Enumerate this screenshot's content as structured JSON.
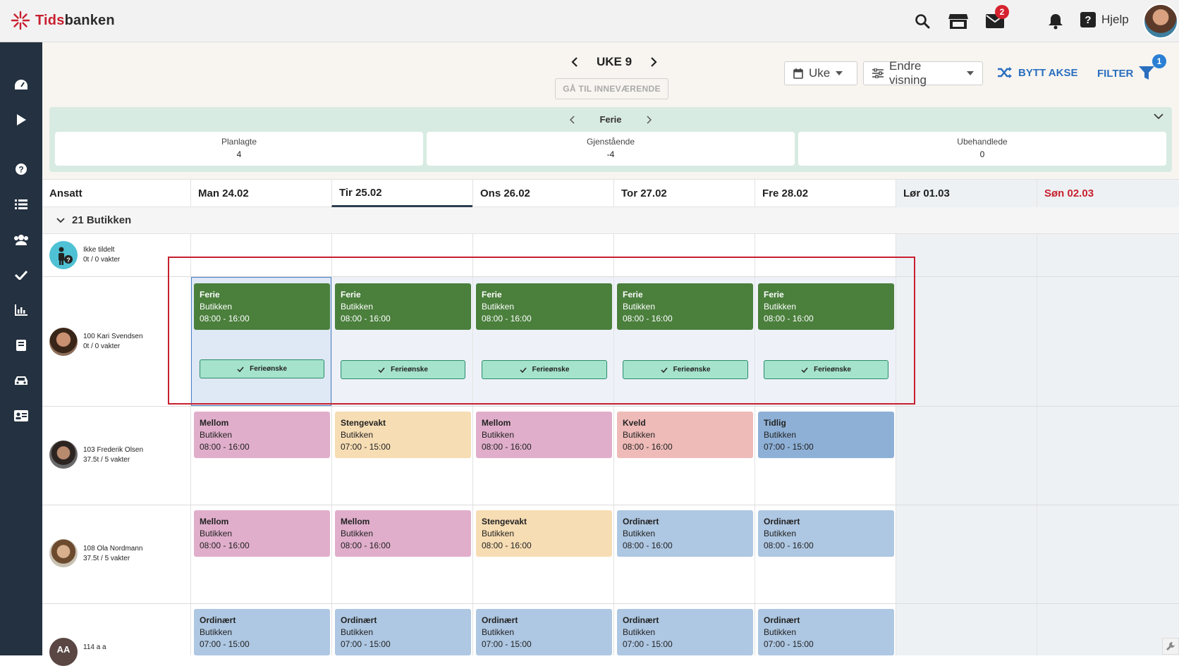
{
  "app": {
    "name_part1": "Tids",
    "name_part2": "banken"
  },
  "topbar": {
    "help_label": "Hjelp",
    "mail_badge": "2"
  },
  "toolbar": {
    "week_label": "UKE 9",
    "goto_current": "GÅ TIL INNEVÆRENDE",
    "view_select": "Uke",
    "change_view": "Endre visning",
    "swap_axis": "BYTT AKSE",
    "filter": "FILTER",
    "filter_badge": "1"
  },
  "summary": {
    "title": "Ferie",
    "cards": [
      {
        "label": "Planlagte",
        "value": "4"
      },
      {
        "label": "Gjenstående",
        "value": "-4"
      },
      {
        "label": "Ubehandlede",
        "value": "0"
      }
    ]
  },
  "grid": {
    "employee_header": "Ansatt",
    "days": [
      "Man 24.02",
      "Tir 25.02",
      "Ons 26.02",
      "Tor 27.02",
      "Fre 28.02",
      "Lør 01.03",
      "Søn 02.03"
    ],
    "group_label": "21 Butikken"
  },
  "employees": [
    {
      "name": "Ikke tildelt",
      "hours": "0t / 0 vakter"
    },
    {
      "name": "100 Kari Svendsen",
      "hours": "0t / 0 vakter"
    },
    {
      "name": "103 Frederik Olsen",
      "hours": "37.5t / 5 vakter"
    },
    {
      "name": "108 Ola Nordmann",
      "hours": "37.5t / 5 vakter"
    },
    {
      "name": "114 a a",
      "initials": "AA"
    }
  ],
  "vacation_row": {
    "shift": {
      "type": "Ferie",
      "location": "Butikken",
      "time": "08:00 - 16:00"
    },
    "chip": "Ferieønske"
  },
  "shifts": {
    "frederik": [
      {
        "type": "Mellom",
        "location": "Butikken",
        "time": "08:00 - 16:00"
      },
      {
        "type": "Stengevakt",
        "location": "Butikken",
        "time": "07:00 - 15:00"
      },
      {
        "type": "Mellom",
        "location": "Butikken",
        "time": "08:00 - 16:00"
      },
      {
        "type": "Kveld",
        "location": "Butikken",
        "time": "08:00 - 16:00"
      },
      {
        "type": "Tidlig",
        "location": "Butikken",
        "time": "07:00 - 15:00"
      }
    ],
    "ola": [
      {
        "type": "Mellom",
        "location": "Butikken",
        "time": "08:00 - 16:00"
      },
      {
        "type": "Mellom",
        "location": "Butikken",
        "time": "08:00 - 16:00"
      },
      {
        "type": "Stengevakt",
        "location": "Butikken",
        "time": "08:00 - 16:00"
      },
      {
        "type": "Ordinært",
        "location": "Butikken",
        "time": "08:00 - 16:00"
      },
      {
        "type": "Ordinært",
        "location": "Butikken",
        "time": "08:00 - 16:00"
      }
    ],
    "aa": [
      {
        "type": "Ordinært",
        "location": "Butikken",
        "time": "07:00 - 15:00"
      },
      {
        "type": "Ordinært",
        "location": "Butikken",
        "time": "07:00 - 15:00"
      },
      {
        "type": "Ordinært",
        "location": "Butikken",
        "time": "07:00 - 15:00"
      },
      {
        "type": "Ordinært",
        "location": "Butikken",
        "time": "07:00 - 15:00"
      },
      {
        "type": "Ordinært",
        "location": "Butikken",
        "time": "07:00 - 15:00"
      }
    ]
  },
  "colors": {
    "ferie": "#4a7f3c",
    "mellom": "#e0aecb",
    "stengevakt": "#f7ddb4",
    "kveld": "#eebbb8",
    "tidlig": "#8eb0d6",
    "ordinaert": "#aec7e2",
    "highlight": "#c8202f"
  }
}
